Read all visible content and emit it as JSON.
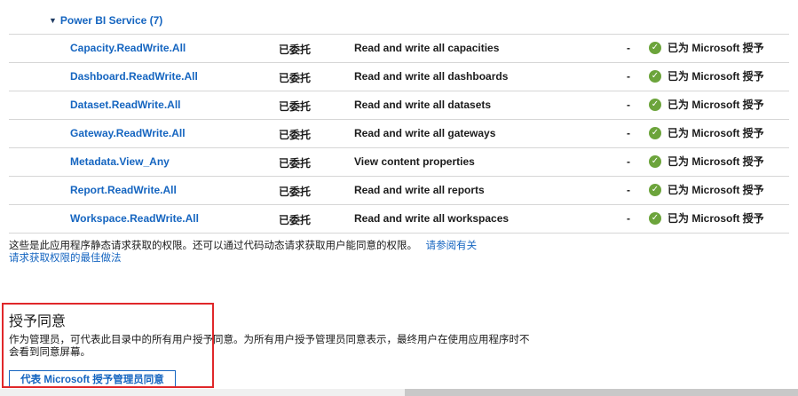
{
  "group": {
    "label": "Power BI Service (7)"
  },
  "permissions": [
    {
      "name": "Capacity.ReadWrite.All",
      "type": "已委托",
      "description": "Read and write all capacities",
      "admin": "-",
      "status": "已为 Microsoft 授予"
    },
    {
      "name": "Dashboard.ReadWrite.All",
      "type": "已委托",
      "description": "Read and write all dashboards",
      "admin": "-",
      "status": "已为 Microsoft 授予"
    },
    {
      "name": "Dataset.ReadWrite.All",
      "type": "已委托",
      "description": "Read and write all datasets",
      "admin": "-",
      "status": "已为 Microsoft 授予"
    },
    {
      "name": "Gateway.ReadWrite.All",
      "type": "已委托",
      "description": "Read and write all gateways",
      "admin": "-",
      "status": "已为 Microsoft 授予"
    },
    {
      "name": "Metadata.View_Any",
      "type": "已委托",
      "description": "View content properties",
      "admin": "-",
      "status": "已为 Microsoft 授予"
    },
    {
      "name": "Report.ReadWrite.All",
      "type": "已委托",
      "description": "Read and write all reports",
      "admin": "-",
      "status": "已为 Microsoft 授予"
    },
    {
      "name": "Workspace.ReadWrite.All",
      "type": "已委托",
      "description": "Read and write all workspaces",
      "admin": "-",
      "status": "已为 Microsoft 授予"
    }
  ],
  "note": {
    "text": "这些是此应用程序静态请求获取的权限。还可以通过代码动态请求获取用户能同意的权限。",
    "link_part1": "请参阅有关",
    "link_part2": "请求获取权限的最佳做法"
  },
  "consent": {
    "title": "授予同意",
    "description": "作为管理员，可代表此目录中的所有用户授予同意。为所有用户授予管理员同意表示，最终用户在使用应用程序时不会看到同意屏幕。",
    "button_label": "代表 Microsoft 授予管理员同意"
  },
  "colors": {
    "link": "#1565c0",
    "check": "#6ca43b",
    "highlight": "#e0272a"
  }
}
